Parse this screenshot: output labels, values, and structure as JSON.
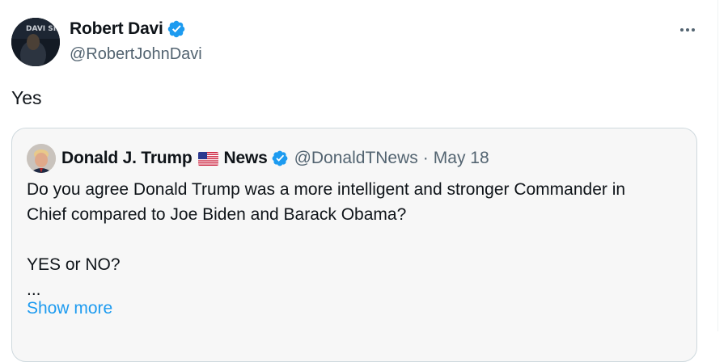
{
  "author": {
    "display_name": "Robert Davi",
    "handle": "@RobertJohnDavi",
    "avatar_text": "DAVI SINATRA"
  },
  "tweet": {
    "text": "Yes"
  },
  "quoted": {
    "name_part1": "Donald J. Trump",
    "name_part2": "News",
    "handle": "@DonaldTNews",
    "separator": "·",
    "date": "May 18",
    "body": "Do you agree Donald Trump was a more intelligent and stronger Commander in\nChief compared to Joe Biden and Barack Obama?\n\nYES or NO?\n...",
    "show_more": "Show more"
  },
  "colors": {
    "verified_blue": "#1d9bf0",
    "link_blue": "#1d9bf0",
    "secondary_text": "#536471",
    "quote_background": "#f7f7f7"
  },
  "icons": [
    "verified-badge-icon",
    "more-options-icon",
    "us-flag-icon"
  ]
}
